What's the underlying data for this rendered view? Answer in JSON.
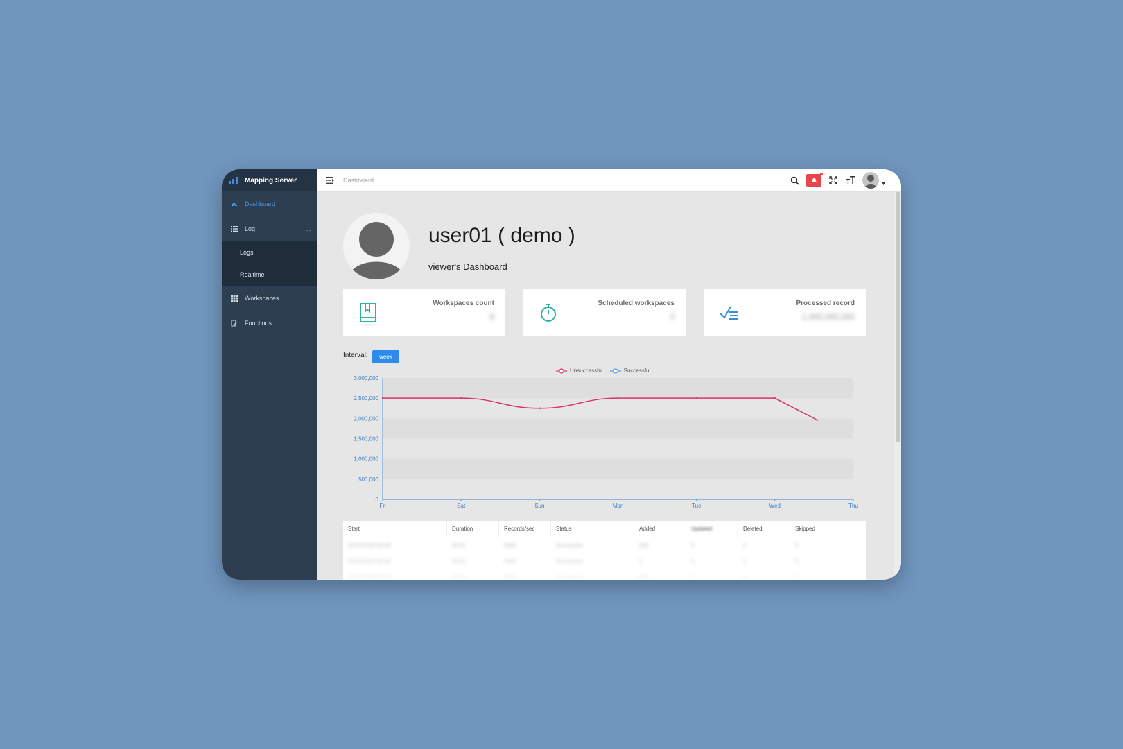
{
  "app": {
    "title": "Mapping Server"
  },
  "sidebar": {
    "items": [
      {
        "label": "Dashboard",
        "icon": "dashboard-icon"
      },
      {
        "label": "Log",
        "icon": "list-icon"
      },
      {
        "label": "Workspaces",
        "icon": "grid-icon"
      },
      {
        "label": "Functions",
        "icon": "function-icon"
      }
    ],
    "log_subitems": [
      {
        "label": "Logs"
      },
      {
        "label": "Realtime"
      }
    ]
  },
  "header": {
    "breadcrumb": "Dashboard"
  },
  "profile": {
    "name": "user01 ( demo )",
    "subtitle": "viewer's Dashboard"
  },
  "stats": [
    {
      "label": "Workspaces count",
      "value": "8",
      "icon": "book-icon",
      "color": "#2bb3a0"
    },
    {
      "label": "Scheduled workspaces",
      "value": "3",
      "icon": "stopwatch-icon",
      "color": "#2bb3a0"
    },
    {
      "label": "Processed record",
      "value": "1,000,000,000",
      "icon": "checklist-icon",
      "color": "#3a8fd6"
    }
  ],
  "interval": {
    "label": "Interval:",
    "button": "week"
  },
  "chart_data": {
    "type": "line",
    "categories": [
      "Fri",
      "Sat",
      "Sun",
      "Mon",
      "Tue",
      "Wed",
      "Thu"
    ],
    "series": [
      {
        "name": "Unsuccessful",
        "color": "#d9336a",
        "values": [
          2500000,
          2500000,
          2250000,
          2500000,
          2500000,
          2500000,
          1500000
        ]
      },
      {
        "name": "Successful",
        "color": "#5b9bd5",
        "values": []
      }
    ],
    "y_ticks": [
      "0",
      "500,000",
      "1,000,000",
      "1,500,000",
      "2,000,000",
      "2,500,000",
      "3,000,000"
    ],
    "ylim": [
      0,
      3000000
    ],
    "grid": true,
    "legend": "top-center"
  },
  "table": {
    "columns": [
      "Start",
      "Duration",
      "Records/sec",
      "Status",
      "Added",
      "Updated",
      "Deleted",
      "Skipped"
    ],
    "rows": [
      [
        "01/01/2020 00:00",
        "00:01",
        "0000",
        "Successful",
        "000",
        "0",
        "0",
        "0"
      ],
      [
        "01/01/2020 00:00",
        "00:01",
        "0000",
        "Successful",
        "0",
        "0",
        "0",
        "0"
      ],
      [
        "01/01/2020 00:00",
        "00:01",
        "0000",
        "Successful",
        "000",
        "0",
        "0",
        "0"
      ]
    ]
  }
}
